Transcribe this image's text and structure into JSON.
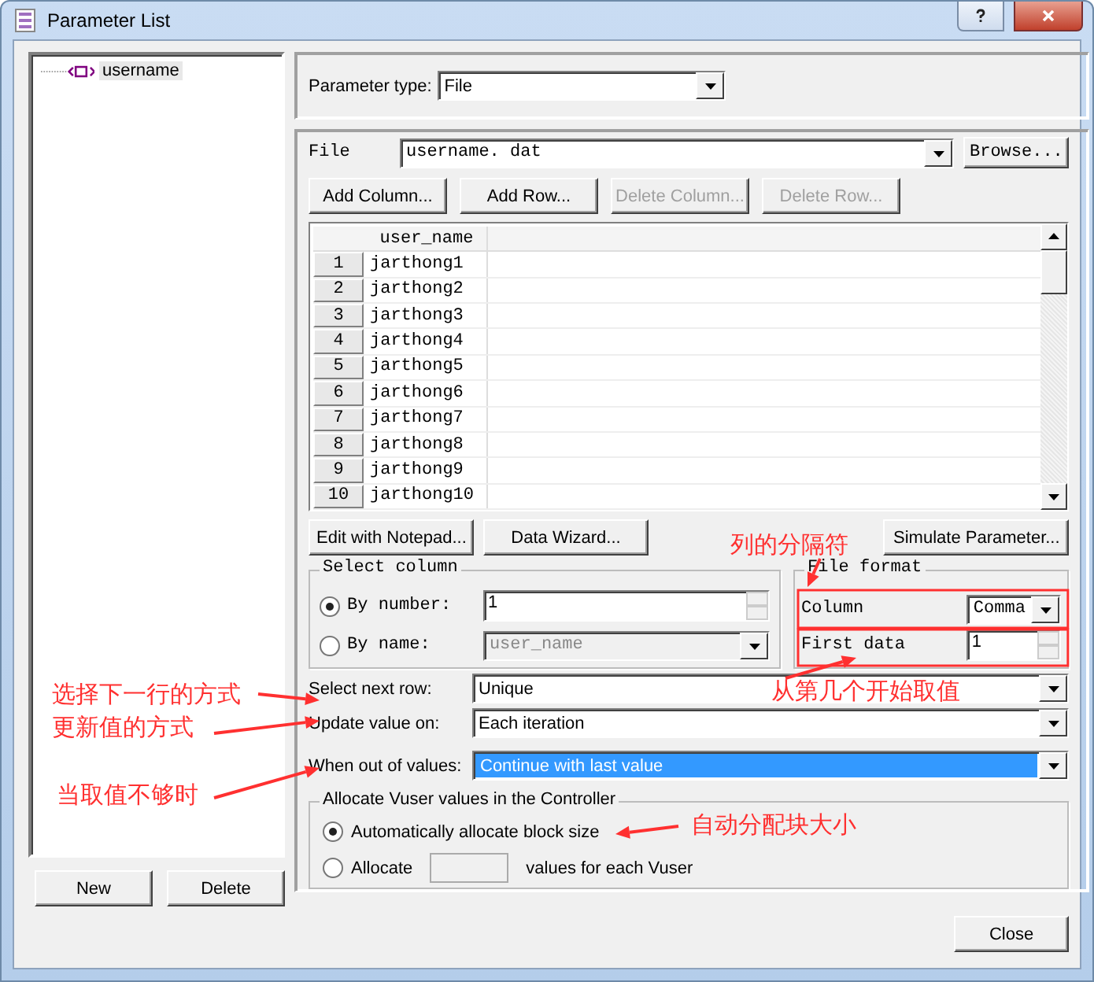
{
  "window": {
    "title": "Parameter List"
  },
  "tree": {
    "items": [
      {
        "label": "username",
        "selected": true
      }
    ]
  },
  "left_buttons": [
    "New",
    "Delete"
  ],
  "parameter_type": {
    "label": "Parameter type:",
    "value": "File"
  },
  "file": {
    "label": "File",
    "value": "username. dat",
    "browse": "Browse..."
  },
  "table_buttons": [
    {
      "label": "Add Column...",
      "disabled": false
    },
    {
      "label": "Add Row...",
      "disabled": false
    },
    {
      "label": "Delete Column...",
      "disabled": true
    },
    {
      "label": "Delete Row...",
      "disabled": true
    }
  ],
  "table": {
    "columns": [
      "user_name"
    ],
    "rows": [
      {
        "index": "1",
        "value": "jarthong1"
      },
      {
        "index": "2",
        "value": "jarthong2"
      },
      {
        "index": "3",
        "value": "jarthong3"
      },
      {
        "index": "4",
        "value": "jarthong4"
      },
      {
        "index": "5",
        "value": "jarthong5"
      },
      {
        "index": "6",
        "value": "jarthong6"
      },
      {
        "index": "7",
        "value": "jarthong7"
      },
      {
        "index": "8",
        "value": "jarthong8"
      },
      {
        "index": "9",
        "value": "jarthong9"
      },
      {
        "index": "10",
        "value": "jarthong10"
      }
    ]
  },
  "action_buttons": [
    "Edit with Notepad...",
    "Data Wizard...",
    "Simulate Parameter..."
  ],
  "select_column": {
    "title": "Select column",
    "options": [
      {
        "label": "By number:",
        "selected": true,
        "value": "1",
        "kind": "spin"
      },
      {
        "label": "By name:",
        "selected": false,
        "value": "user_name",
        "kind": "combo"
      }
    ]
  },
  "file_format": {
    "title": "File format",
    "column": {
      "label": "Column",
      "value": "Comma"
    },
    "first_data": {
      "label": "First data",
      "value": "1"
    }
  },
  "settings": [
    {
      "label": "Select next row:",
      "value": "Unique",
      "highlighted": false
    },
    {
      "label": "Update value on:",
      "value": "Each iteration",
      "highlighted": false
    },
    {
      "label": "When out of values:",
      "value": "Continue with last value",
      "highlighted": true
    }
  ],
  "allocate": {
    "title": "Allocate Vuser values in the Controller",
    "options": [
      {
        "label": "Automatically allocate block size",
        "selected": true
      },
      {
        "label": "Allocate",
        "label_after": "values for each Vuser",
        "selected": false
      }
    ]
  },
  "close_button": "Close",
  "annotations": [
    {
      "text": "列的分隔符"
    },
    {
      "text": "选择下一行的方式"
    },
    {
      "text": "从第几个开始取值"
    },
    {
      "text": "更新值的方式"
    },
    {
      "text": "当取值不够时"
    },
    {
      "text": "自动分配块大小"
    }
  ]
}
